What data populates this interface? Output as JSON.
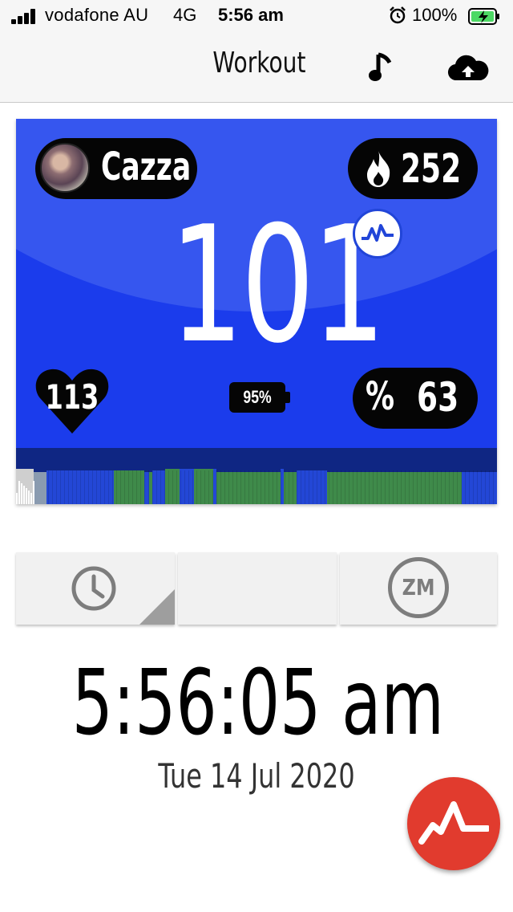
{
  "status_bar": {
    "carrier": "vodafone AU",
    "network": "4G",
    "time": "5:56 am",
    "battery_percent": "100%",
    "icons": [
      "signal-icon",
      "alarm-icon",
      "battery-charging-icon"
    ]
  },
  "nav": {
    "title": "Workout",
    "music_icon": "music-note-icon",
    "upload_icon": "cloud-upload-icon"
  },
  "workout_card": {
    "user_name": "Cazza",
    "calories": "252",
    "heart_rate_effort": "101",
    "heart_rate_bpm": "113",
    "belt_battery": "95%",
    "percent_symbol": "%",
    "percent_max_hr": "63",
    "colors": {
      "card_bg": "#1b3cec",
      "zone_blue": "#2347d6",
      "zone_green": "#3f8a4a",
      "zone_gray": "#cfcfcf"
    }
  },
  "controls": {
    "clock_icon": "clock-icon",
    "zm_label": "ZM"
  },
  "time_display": {
    "time": "5:56:05 am",
    "date": "Tue 14 Jul 2020"
  },
  "fab": {
    "icon": "myzone-pulse-icon"
  }
}
